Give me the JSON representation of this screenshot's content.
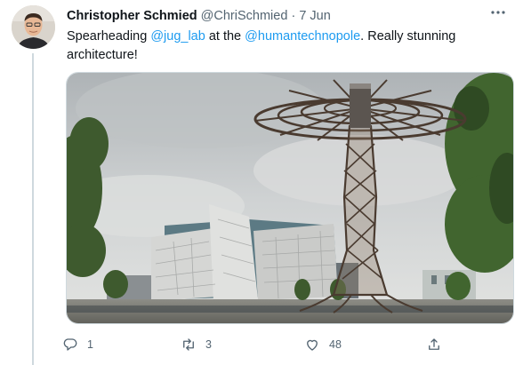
{
  "tweet": {
    "author_name": "Christopher Schmied",
    "handle": "@ChriSchmied",
    "separator": "·",
    "date": "7 Jun",
    "text_parts": {
      "t1": "Spearheading ",
      "m1": "@jug_lab",
      "t2": " at the ",
      "m2": "@humantechnopole",
      "t3": ". Really stunning architecture!"
    }
  },
  "actions": {
    "reply_count": "1",
    "retweet_count": "3",
    "like_count": "48"
  },
  "icons": {
    "more": "more-icon",
    "reply": "reply-icon",
    "retweet": "retweet-icon",
    "like": "like-icon",
    "share": "share-icon"
  },
  "colors": {
    "link": "#1d9bf0",
    "muted": "#536471",
    "text": "#0f1419"
  }
}
